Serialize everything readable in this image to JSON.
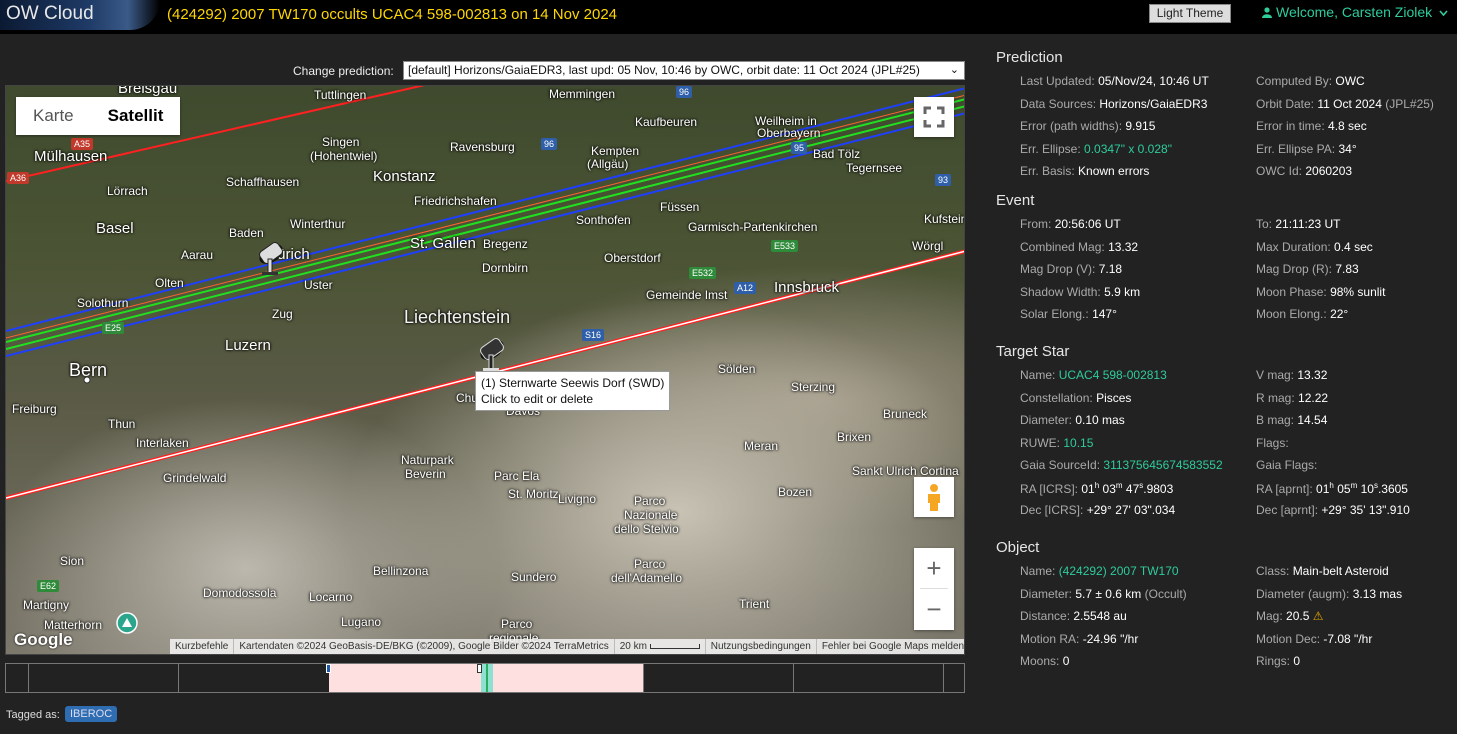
{
  "header": {
    "logo": "OW Cloud",
    "title": "(424292) 2007 TW170 occults UCAC4 598-002813 on 14 Nov 2024",
    "theme_button": "Light Theme",
    "welcome": "Welcome, Carsten Ziolek"
  },
  "prediction_select": {
    "label": "Change prediction:",
    "value": "[default] Horizons/GaiaEDR3, last upd: 05 Nov, 10:46 by OWC, orbit date: 11 Oct 2024 (JPL#25)"
  },
  "map": {
    "map_types": [
      "Karte",
      "Satellit"
    ],
    "active_type": "Satellit",
    "tooltip_line1": "(1) Sternwarte Seewis Dorf (SWD)",
    "tooltip_line2": "Click to edit or delete",
    "google": "Google",
    "attribution": [
      "Kurzbefehle",
      "Kartendaten ©2024 GeoBasis-DE/BKG (©2009), Google Bilder ©2024 TerraMetrics",
      "20 km",
      "Nutzungsbedingungen",
      "Fehler bei Google Maps melden"
    ],
    "zoom_in": "+",
    "zoom_out": "−",
    "places": {
      "breisgau": "Breisgau",
      "mulhausen": "Mülhausen",
      "lorrach": "Lörrach",
      "basel": "Basel",
      "schaffhausen": "Schaffhausen",
      "singen": "Singen",
      "hohentwiel": "(Hohentwiel)",
      "konstanz": "Konstanz",
      "ravensburg": "Ravensburg",
      "tuttlingen": "Tuttlingen",
      "memmingen": "Memmingen",
      "kaufbeuren": "Kaufbeuren",
      "weilheim": "Weilheim in",
      "oberbayern": "Oberbayern",
      "kempten": "Kempten",
      "allgau": "(Allgäu)",
      "badtolz": "Bad Tölz",
      "tegernsee": "Tegernsee",
      "friedrichshafen": "Friedrichshafen",
      "winterthur": "Winterthur",
      "baden": "Baden",
      "zurich": "Zürich",
      "aarau": "Aarau",
      "olten": "Olten",
      "uster": "Uster",
      "stgallen": "St. Gallen",
      "bregenz": "Bregenz",
      "dornbirn": "Dornbirn",
      "sonthofen": "Sonthofen",
      "fussen": "Füssen",
      "garmisch": "Garmisch-Partenkirchen",
      "kufstein": "Kufstein",
      "worgl": "Wörgl",
      "oberstdorf": "Oberstdorf",
      "gemeinde": "Gemeinde Imst",
      "innsbruck": "Innsbruck",
      "solothurn": "Solothurn",
      "zug": "Zug",
      "luzern": "Luzern",
      "liechtenstein": "Liechtenstein",
      "bern": "Bern",
      "freiburg": "Freiburg",
      "thun": "Thun",
      "interlaken": "Interlaken",
      "chur": "Chur",
      "davos": "Davos",
      "solden": "Sölden",
      "sterzing": "Sterzing",
      "bruneck": "Bruneck",
      "meran": "Meran",
      "brixen": "Brixen",
      "grindelwald": "Grindelwald",
      "naturpark": "Naturpark",
      "beverin": "Beverin",
      "parcela": "Parc Ela",
      "stmoritz": "St. Moritz",
      "livigno": "Livigno",
      "parco1": "Parco",
      "nazionale": "Nazionale",
      "stelvio": "dello Stelvio",
      "santulrich": "Sankt Ulrich",
      "cortina": "Cortina",
      "bozen": "Bozen",
      "sion": "Sion",
      "bellinzona": "Bellinzona",
      "sondrio": "Sundero",
      "parco2": "Parco",
      "adamello": "dell'Adamello",
      "domodossola": "Domodossola",
      "locarno": "Locarno",
      "lugano": "Lugano",
      "trient": "Trient",
      "martigny": "Martigny",
      "matterhorn": "Matterhorn",
      "parco3": "Parco",
      "regionale": "regionale"
    },
    "road_badges": {
      "a35": "A35",
      "a36": "A36",
      "b96a": "96",
      "b96b": "96",
      "b95": "95",
      "b93": "93",
      "e33": "E533",
      "e532": "E532",
      "a12": "A12",
      "s16": "S16",
      "e25": "E25",
      "e62": "E62"
    }
  },
  "tagged": {
    "label": "Tagged as:",
    "tag": "IBEROC"
  },
  "panel": {
    "prediction": {
      "title": "Prediction",
      "last_updated_label": "Last Updated:",
      "last_updated": "05/Nov/24, 10:46 UT",
      "computed_by_label": "Computed By:",
      "computed_by": "OWC",
      "data_sources_label": "Data Sources:",
      "data_sources": "Horizons/GaiaEDR3",
      "orbit_date_label": "Orbit Date:",
      "orbit_date": "11 Oct 2024",
      "orbit_jpl": "(JPL#25)",
      "error_paths_label": "Error (path widths):",
      "error_paths": "9.915",
      "error_time_label": "Error in time:",
      "error_time": "4.8 sec",
      "err_ellipse_label": "Err. Ellipse:",
      "err_ellipse": "0.0347\" x 0.028\"",
      "err_ellipse_pa_label": "Err. Ellipse PA:",
      "err_ellipse_pa": "34°",
      "err_basis_label": "Err. Basis:",
      "err_basis": "Known errors",
      "owc_id_label": "OWC Id:",
      "owc_id": "2060203"
    },
    "event": {
      "title": "Event",
      "from_label": "From:",
      "from": "20:56:06 UT",
      "to_label": "To:",
      "to": "21:11:23 UT",
      "combined_mag_label": "Combined Mag:",
      "combined_mag": "13.32",
      "max_duration_label": "Max Duration:",
      "max_duration": "0.4 sec",
      "mag_drop_v_label": "Mag Drop (V):",
      "mag_drop_v": "7.18",
      "mag_drop_r_label": "Mag Drop (R):",
      "mag_drop_r": "7.83",
      "shadow_width_label": "Shadow Width:",
      "shadow_width": "5.9 km",
      "moon_phase_label": "Moon Phase:",
      "moon_phase": "98% sunlit",
      "solar_elong_label": "Solar Elong.:",
      "solar_elong": "147°",
      "moon_elong_label": "Moon Elong.:",
      "moon_elong": "22°"
    },
    "target_star": {
      "title": "Target Star",
      "name_label": "Name:",
      "name": "UCAC4 598-002813",
      "vmag_label": "V mag:",
      "vmag": "13.32",
      "constellation_label": "Constellation:",
      "constellation": "Pisces",
      "rmag_label": "R mag:",
      "rmag": "12.22",
      "diameter_label": "Diameter:",
      "diameter": "0.10 mas",
      "bmag_label": "B mag:",
      "bmag": "14.54",
      "ruwe_label": "RUWE:",
      "ruwe": "10.15",
      "flags_label": "Flags:",
      "gaia_source_label": "Gaia SourceId:",
      "gaia_source": "311375645674583552",
      "gaia_flags_label": "Gaia Flags:",
      "ra_icrs_label": "RA [ICRS]:",
      "ra_icrs_h": "01",
      "ra_icrs_m": "03",
      "ra_icrs_s": "47",
      "ra_icrs_frac": ".9803",
      "ra_aprnt_label": "RA [aprnt]:",
      "ra_aprnt_h": "01",
      "ra_aprnt_m": "05",
      "ra_aprnt_s": "10",
      "ra_aprnt_frac": ".3605",
      "dec_icrs_label": "Dec [ICRS]:",
      "dec_icrs": "+29° 27' 03\".034",
      "dec_aprnt_label": "Dec [aprnt]:",
      "dec_aprnt": "+29° 35' 13\".910"
    },
    "object": {
      "title": "Object",
      "name_label": "Name:",
      "name": "(424292) 2007 TW170",
      "class_label": "Class:",
      "class": "Main-belt Asteroid",
      "diameter_label": "Diameter:",
      "diameter": "5.7 ± 0.6 km",
      "diameter_src": "(Occult)",
      "diam_augm_label": "Diameter (augm):",
      "diam_augm": "3.13 mas",
      "distance_label": "Distance:",
      "distance": "2.5548 au",
      "mag_label": "Mag:",
      "mag": "20.5",
      "motion_ra_label": "Motion RA:",
      "motion_ra": "-24.96 \"/hr",
      "motion_dec_label": "Motion Dec:",
      "motion_dec": "-7.08 \"/hr",
      "moons_label": "Moons:",
      "moons": "0",
      "rings_label": "Rings:",
      "rings": "0"
    }
  },
  "colors": {
    "accent_green": "#2ecc9b",
    "title_yellow": "#ffd700",
    "path_blue": "#1f3fff",
    "path_green": "#20e020",
    "path_red": "#ff2020"
  }
}
